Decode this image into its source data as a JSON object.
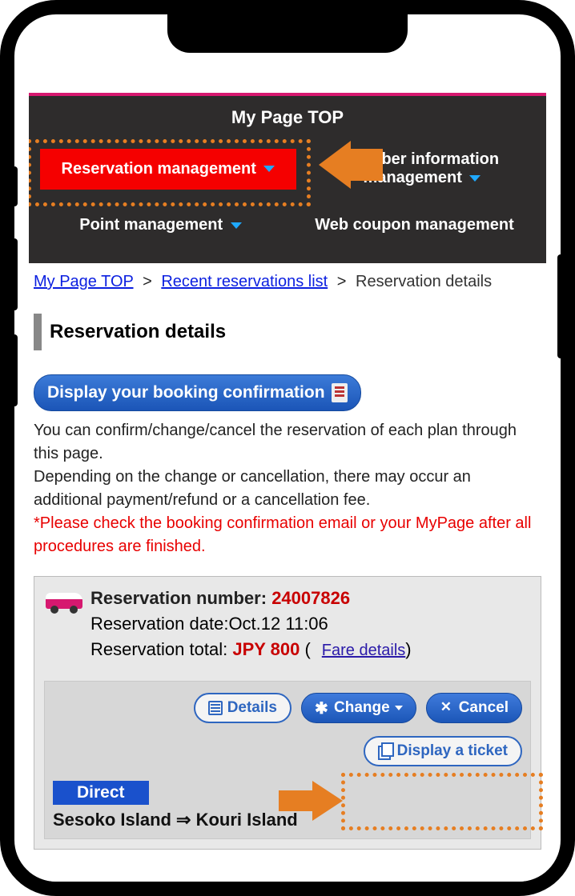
{
  "header": {
    "title": "My Page TOP",
    "nav": {
      "reservation": "Reservation management",
      "member": "Member information management",
      "point": "Point management",
      "coupon": "Web coupon management"
    }
  },
  "breadcrumb": {
    "top": "My Page TOP",
    "recent": "Recent reservations list",
    "current": "Reservation details"
  },
  "page_title": "Reservation details",
  "confirm_button": "Display your booking confirmation",
  "notice": {
    "line1": "You can confirm/change/cancel the reservation of each plan through this page.",
    "line2": "Depending on the change or cancellation, there may occur an additional payment/refund or a cancellation fee.",
    "warning": "*Please check the booking confirmation email or your MyPage after all procedures are finished."
  },
  "reservation": {
    "number_label": "Reservation number:",
    "number": "24007826",
    "date_label": "Reservation date:",
    "date": "Oct.12 11:06",
    "total_label": "Reservation total:",
    "total": "JPY 800",
    "fare_link": "Fare details",
    "actions": {
      "details": "Details",
      "change": "Change",
      "cancel": "Cancel",
      "ticket": "Display a ticket"
    },
    "direct_badge": "Direct",
    "route": "Sesoko Island ⇒ Kouri Island"
  }
}
